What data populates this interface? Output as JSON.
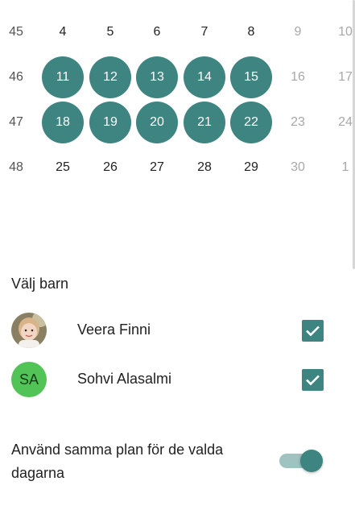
{
  "calendar": {
    "weeks": [
      {
        "week": "45",
        "days": [
          "4",
          "5",
          "6",
          "7",
          "8",
          "9",
          "10"
        ],
        "selected": [
          false,
          false,
          false,
          false,
          false,
          false,
          false
        ]
      },
      {
        "week": "46",
        "days": [
          "11",
          "12",
          "13",
          "14",
          "15",
          "16",
          "17"
        ],
        "selected": [
          true,
          true,
          true,
          true,
          true,
          false,
          false
        ]
      },
      {
        "week": "47",
        "days": [
          "18",
          "19",
          "20",
          "21",
          "22",
          "23",
          "24"
        ],
        "selected": [
          true,
          true,
          true,
          true,
          true,
          false,
          false
        ]
      },
      {
        "week": "48",
        "days": [
          "25",
          "26",
          "27",
          "28",
          "29",
          "30",
          "1"
        ],
        "selected": [
          false,
          false,
          false,
          false,
          false,
          false,
          false
        ]
      }
    ]
  },
  "children_section": {
    "title": "Välj barn",
    "children": [
      {
        "name": "Veera Finni",
        "avatar": "photo",
        "checked": true
      },
      {
        "name": "Sohvi Alasalmi",
        "avatar_initials": "SA",
        "checked": true
      }
    ]
  },
  "same_plan": {
    "label": "Använd samma plan för de valda dagarna",
    "enabled": true
  },
  "colors": {
    "accent": "#3e8480",
    "accent_light": "#9fc3c1",
    "initials_avatar": "#52c457",
    "weekend_text": "#a8a8a8"
  }
}
